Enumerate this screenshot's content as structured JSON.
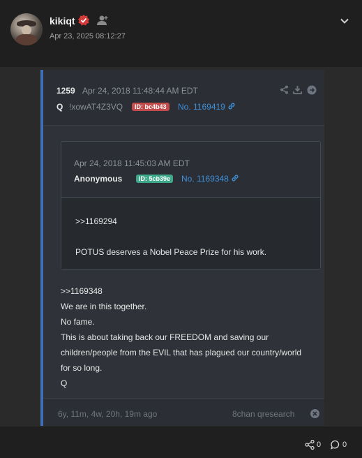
{
  "header": {
    "username": "kikiqt",
    "timestamp": "Apr 23, 2025 08:12:27",
    "icons": [
      "verified-icon",
      "follow-icon",
      "chevron-down-icon"
    ]
  },
  "drop": {
    "number": "1259",
    "date": "Apr 24, 2018 11:48:44 AM EDT",
    "author": "Q",
    "tripcode": "!xowAT4Z3VQ",
    "id": "ID: bc4b43",
    "post_link": "No. 1169419",
    "quote": {
      "date": "Apr 24, 2018 11:45:03 AM EDT",
      "author": "Anonymous",
      "id": "ID: 5cb39e",
      "post_link": "No. 1169348",
      "ref": ">>1169294",
      "text": "POTUS deserves a Nobel Peace Prize for his work."
    },
    "lines": [
      ">>1169348",
      "We are in this together.",
      "No fame.",
      "This is about taking back our FREEDOM and saving our children/people from the EVIL that has plagued our country/world for so long.",
      "Q"
    ],
    "ago": "6y, 11m, 4w, 20h, 19m ago",
    "source": "8chan qresearch"
  },
  "footer": {
    "shares": "0",
    "comments": "0"
  },
  "colors": {
    "accent_blue": "#3f8fd8",
    "id_red": "#c24b4b",
    "id_green": "#3ea88a",
    "verified_red": "#d63b3b"
  }
}
